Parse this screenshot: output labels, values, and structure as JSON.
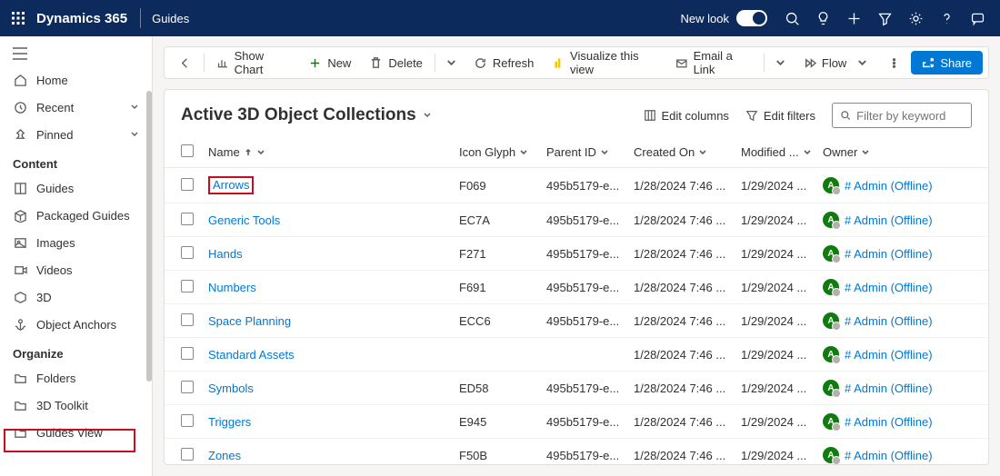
{
  "topbar": {
    "brand": "Dynamics 365",
    "app": "Guides",
    "new_look": "New look"
  },
  "nav": {
    "home": "Home",
    "recent": "Recent",
    "pinned": "Pinned",
    "section_content": "Content",
    "guides": "Guides",
    "packaged": "Packaged Guides",
    "images": "Images",
    "videos": "Videos",
    "three_d": "3D",
    "anchors": "Object Anchors",
    "section_organize": "Organize",
    "folders": "Folders",
    "toolkit": "3D Toolkit",
    "guides_view": "Guides View"
  },
  "cmdbar": {
    "show_chart": "Show Chart",
    "new": "New",
    "delete": "Delete",
    "refresh": "Refresh",
    "visualize": "Visualize this view",
    "email": "Email a Link",
    "flow": "Flow",
    "share": "Share"
  },
  "view": {
    "title": "Active 3D Object Collections",
    "edit_columns": "Edit columns",
    "edit_filters": "Edit filters",
    "search_placeholder": "Filter by keyword"
  },
  "columns": {
    "name": "Name",
    "icon": "Icon Glyph",
    "parent": "Parent ID",
    "created": "Created On",
    "modified": "Modified ...",
    "owner": "Owner"
  },
  "rows": [
    {
      "name": "Arrows",
      "icon": "F069",
      "parent": "495b5179-e...",
      "created": "1/28/2024 7:46 ...",
      "modified": "1/29/2024 ...",
      "owner": "# Admin (Offline)",
      "highlight": true
    },
    {
      "name": "Generic Tools",
      "icon": "EC7A",
      "parent": "495b5179-e...",
      "created": "1/28/2024 7:46 ...",
      "modified": "1/29/2024 ...",
      "owner": "# Admin (Offline)"
    },
    {
      "name": "Hands",
      "icon": "F271",
      "parent": "495b5179-e...",
      "created": "1/28/2024 7:46 ...",
      "modified": "1/29/2024 ...",
      "owner": "# Admin (Offline)"
    },
    {
      "name": "Numbers",
      "icon": "F691",
      "parent": "495b5179-e...",
      "created": "1/28/2024 7:46 ...",
      "modified": "1/29/2024 ...",
      "owner": "# Admin (Offline)"
    },
    {
      "name": "Space Planning",
      "icon": "ECC6",
      "parent": "495b5179-e...",
      "created": "1/28/2024 7:46 ...",
      "modified": "1/29/2024 ...",
      "owner": "# Admin (Offline)"
    },
    {
      "name": "Standard Assets",
      "icon": "",
      "parent": "",
      "created": "1/28/2024 7:46 ...",
      "modified": "1/29/2024 ...",
      "owner": "# Admin (Offline)"
    },
    {
      "name": "Symbols",
      "icon": "ED58",
      "parent": "495b5179-e...",
      "created": "1/28/2024 7:46 ...",
      "modified": "1/29/2024 ...",
      "owner": "# Admin (Offline)"
    },
    {
      "name": "Triggers",
      "icon": "E945",
      "parent": "495b5179-e...",
      "created": "1/28/2024 7:46 ...",
      "modified": "1/29/2024 ...",
      "owner": "# Admin (Offline)"
    },
    {
      "name": "Zones",
      "icon": "F50B",
      "parent": "495b5179-e...",
      "created": "1/28/2024 7:46 ...",
      "modified": "1/29/2024 ...",
      "owner": "# Admin (Offline)"
    }
  ]
}
